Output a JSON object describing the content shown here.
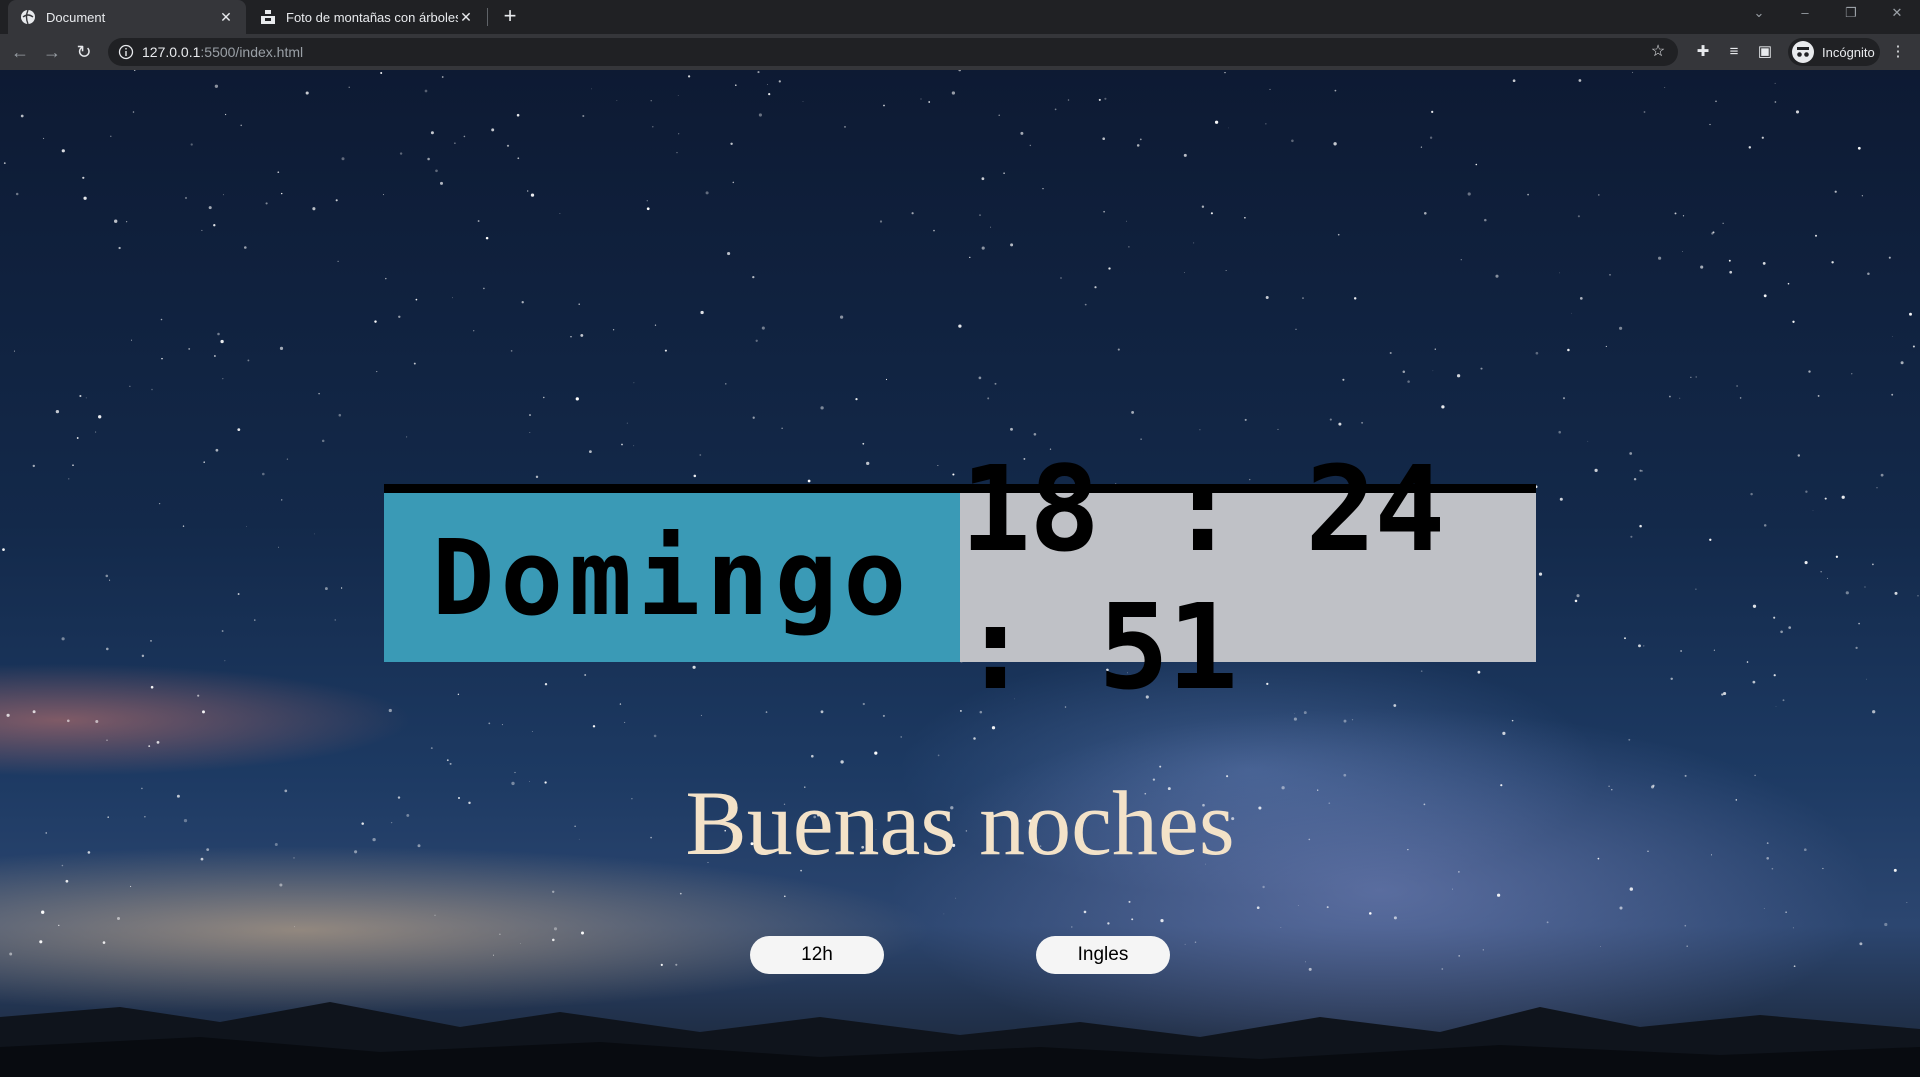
{
  "browser": {
    "tabs": [
      {
        "title": "Document",
        "active": true
      },
      {
        "title": "Foto de montañas con árboles b",
        "active": false
      }
    ],
    "url_host": "127.0.0.1",
    "url_path": ":5500/index.html",
    "profile_label": "Incógnito"
  },
  "clock": {
    "day": "Domingo",
    "time": "18 : 24 : 51"
  },
  "greeting": "Buenas noches",
  "buttons": {
    "format_label": "12h",
    "language_label": "Ingles"
  },
  "colors": {
    "day_bg": "#3a9ab6",
    "time_bg": "#bfc1c6",
    "greeting": "#f3e2c8"
  }
}
